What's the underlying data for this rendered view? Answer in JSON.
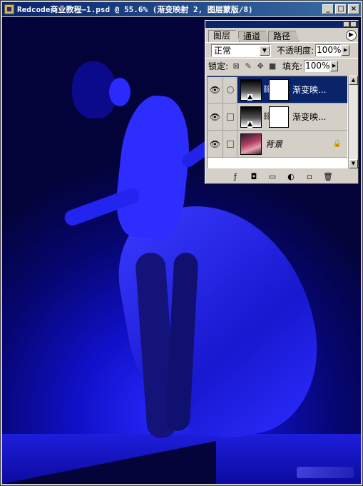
{
  "window": {
    "title": "Redcode商业教程—1.psd @ 55.6% (渐变映射 2, 图层蒙版/8)",
    "buttons": {
      "minimize": "_",
      "maximize": "□",
      "close": "×"
    }
  },
  "layers_panel": {
    "tabs": [
      {
        "label": "图层",
        "active": true
      },
      {
        "label": "通道",
        "active": false
      },
      {
        "label": "路径",
        "active": false
      }
    ],
    "blend_mode": "正常",
    "opacity_label": "不透明度:",
    "opacity_value": "100%",
    "lock_label": "锁定:",
    "fill_label": "填充:",
    "fill_value": "100%",
    "layers": [
      {
        "name": "渐变映...",
        "type": "adjustment",
        "selected": true,
        "visible": true
      },
      {
        "name": "渐变映...",
        "type": "adjustment",
        "selected": false,
        "visible": true
      },
      {
        "name": "背景",
        "type": "background",
        "selected": false,
        "visible": true,
        "locked": true
      }
    ],
    "bottom_icons": [
      "link-layers-icon",
      "layer-style-icon",
      "add-mask-icon",
      "new-group-icon",
      "new-adjustment-layer-icon",
      "new-layer-icon",
      "delete-layer-icon"
    ]
  },
  "colors": {
    "title_bar": "#0a246a",
    "canvas_blue": "#1a1aff",
    "selection": "#0a246a"
  }
}
